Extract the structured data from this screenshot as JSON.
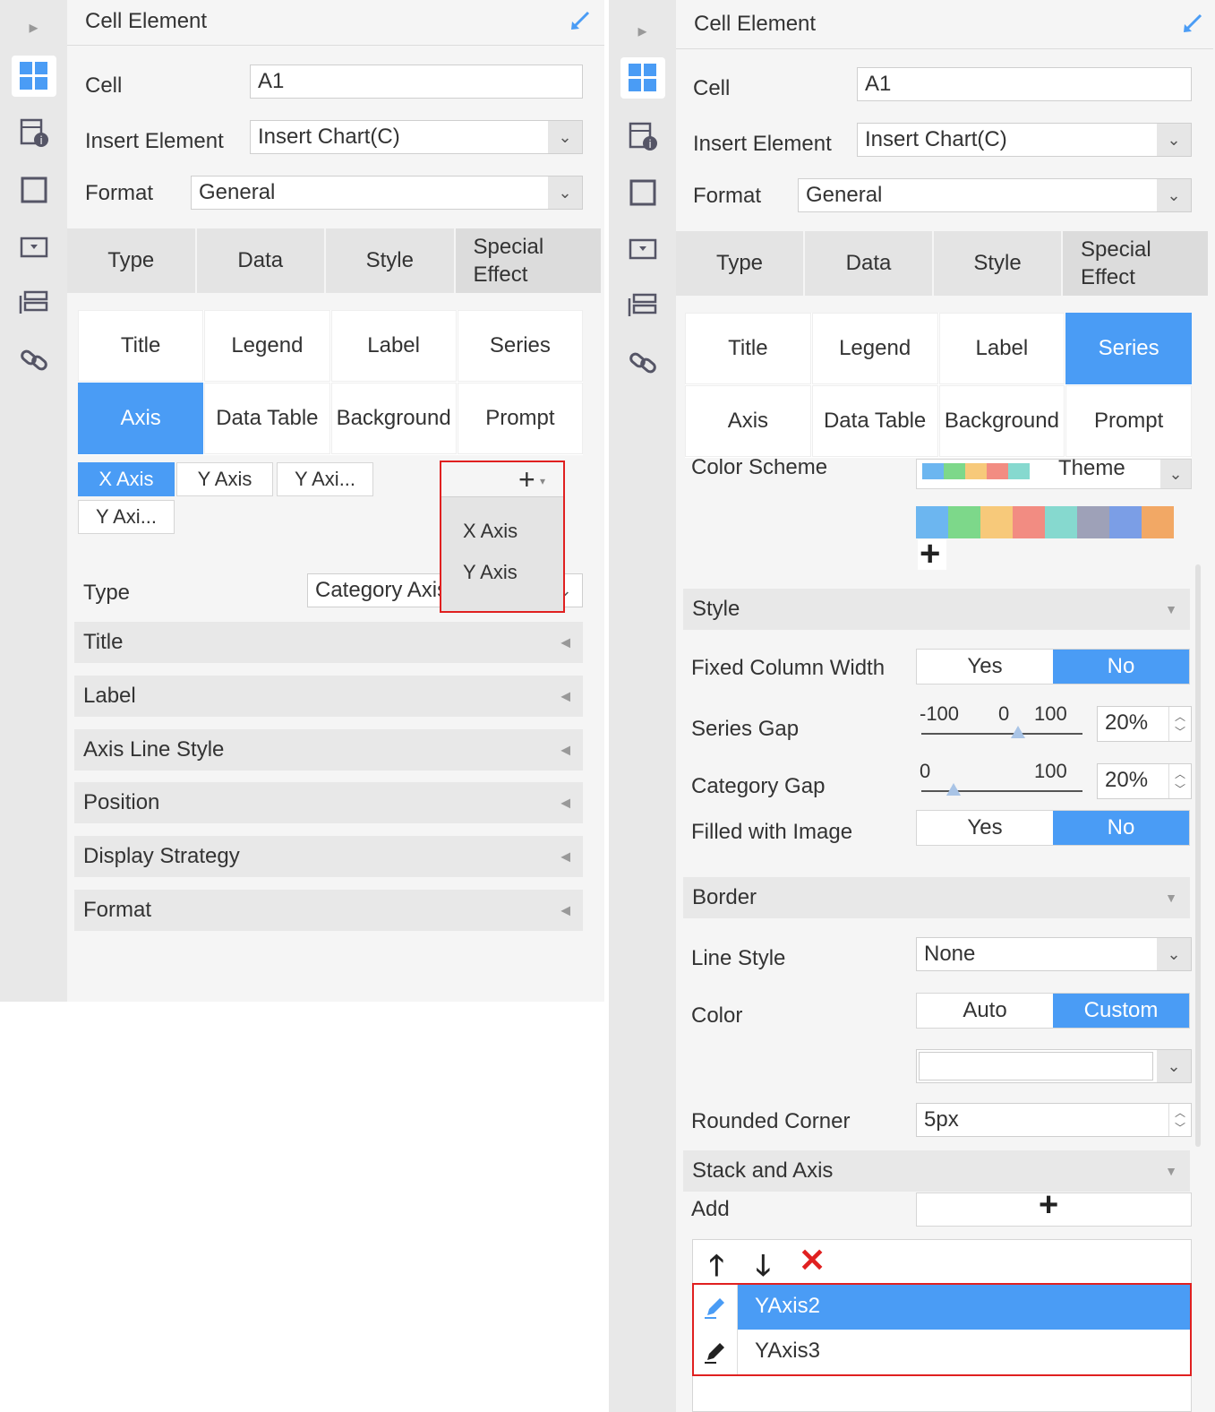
{
  "left": {
    "header_title": "Cell Element",
    "cell_label": "Cell",
    "cell_value": "A1",
    "insert_label": "Insert Element",
    "insert_value": "Insert Chart(C)",
    "format_label": "Format",
    "format_value": "General",
    "tabs": [
      "Type",
      "Data",
      "Style",
      "Special Effect"
    ],
    "grid": [
      "Title",
      "Legend",
      "Label",
      "Series",
      "Axis",
      "Data Table",
      "Background",
      "Prompt"
    ],
    "selected_grid": "Axis",
    "axis_tabs": [
      "X Axis",
      "Y Axis",
      "Y Axi...",
      "Y Axi..."
    ],
    "dropdown_items": [
      "X Axis",
      "Y Axis"
    ],
    "type_label": "Type",
    "type_value": "Category Axis",
    "sections": [
      "Title",
      "Label",
      "Axis Line Style",
      "Position",
      "Display Strategy",
      "Format"
    ]
  },
  "right": {
    "header_title": "Cell Element",
    "cell_label": "Cell",
    "cell_value": "A1",
    "insert_label": "Insert Element",
    "insert_value": "Insert Chart(C)",
    "format_label": "Format",
    "format_value": "General",
    "tabs": [
      "Type",
      "Data",
      "Style",
      "Special Effect"
    ],
    "grid": [
      "Title",
      "Legend",
      "Label",
      "Series",
      "Axis",
      "Data Table",
      "Background",
      "Prompt"
    ],
    "selected_grid": "Series",
    "color_scheme_label": "Color Scheme",
    "color_scheme_value": "Theme",
    "palette": [
      "#6cb6f0",
      "#7dd88a",
      "#f7c97a",
      "#f28c82",
      "#86d9cf",
      "#9ea1b8",
      "#7b9ee6",
      "#f2a865"
    ],
    "style_section": "Style",
    "fixed_width_label": "Fixed Column Width",
    "yes": "Yes",
    "no": "No",
    "series_gap_label": "Series Gap",
    "series_gap_ticks": [
      "-100",
      "0",
      "100"
    ],
    "series_gap_value": "20%",
    "category_gap_label": "Category Gap",
    "category_gap_ticks": [
      "0",
      "100"
    ],
    "category_gap_value": "20%",
    "filled_image_label": "Filled with Image",
    "border_section": "Border",
    "line_style_label": "Line Style",
    "line_style_value": "None",
    "color_label": "Color",
    "auto": "Auto",
    "custom": "Custom",
    "rounded_label": "Rounded Corner",
    "rounded_value": "5px",
    "stack_section": "Stack and Axis",
    "add_label": "Add",
    "axis_list": [
      "YAxis2",
      "YAxis3"
    ]
  }
}
